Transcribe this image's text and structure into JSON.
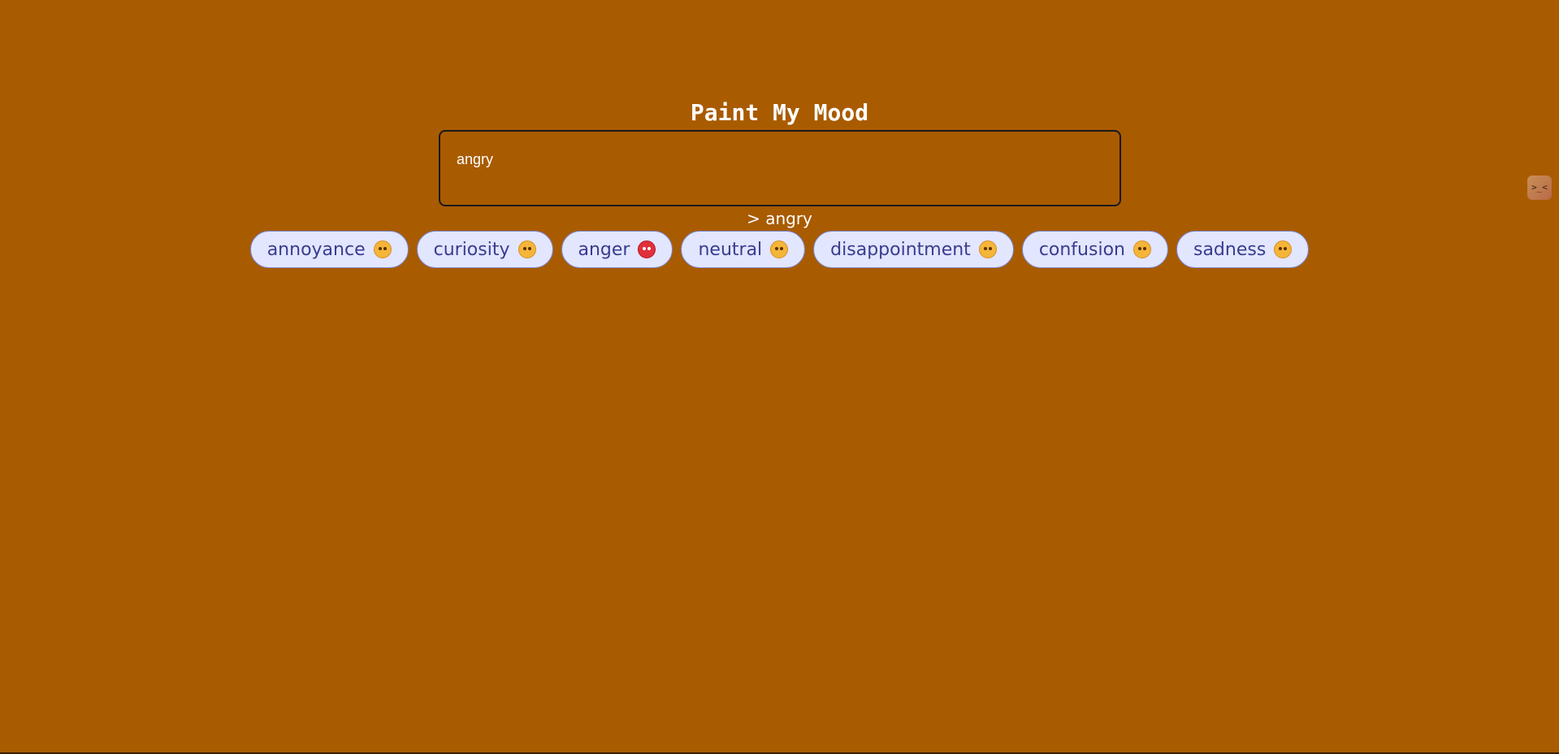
{
  "page": {
    "title": "Paint My Mood",
    "background_color": "#a95b00"
  },
  "mood_input": {
    "value": "angry"
  },
  "echo": {
    "text": "> angry"
  },
  "emotions": [
    {
      "label": "annoyance",
      "icon": "annoyed-face-icon"
    },
    {
      "label": "curiosity",
      "icon": "thinking-face-icon"
    },
    {
      "label": "anger",
      "icon": "angry-red-face-icon"
    },
    {
      "label": "neutral",
      "icon": "neutral-face-icon"
    },
    {
      "label": "disappointment",
      "icon": "disappointed-face-icon"
    },
    {
      "label": "confusion",
      "icon": "confused-face-icon"
    },
    {
      "label": "sadness",
      "icon": "sad-face-icon"
    }
  ],
  "side_widget": {
    "text": ">_<",
    "icon": "extension-icon"
  },
  "colors": {
    "chip_background": "#e2e6ff",
    "chip_text": "#3a3c8f"
  }
}
